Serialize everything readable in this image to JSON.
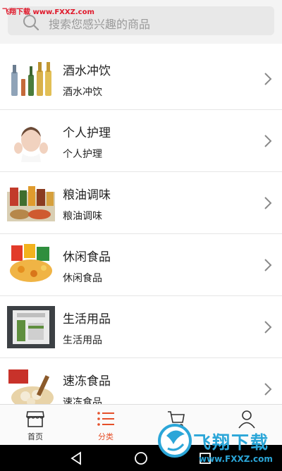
{
  "watermark_top": "飞翔下载 www.FXXZ.com",
  "search": {
    "placeholder": "搜索您感兴趣的商品",
    "icon": "search-icon"
  },
  "categories": [
    {
      "title": "酒水冲饮",
      "subtitle": "酒水冲饮"
    },
    {
      "title": "个人护理",
      "subtitle": "个人护理"
    },
    {
      "title": "粮油调味",
      "subtitle": "粮油调味"
    },
    {
      "title": "休闲食品",
      "subtitle": "休闲食品"
    },
    {
      "title": "生活用品",
      "subtitle": "生活用品"
    },
    {
      "title": "速冻食品",
      "subtitle": "速冻食品"
    }
  ],
  "tabbar": {
    "tabs": [
      {
        "label": "首页",
        "icon": "store-icon"
      },
      {
        "label": "分类",
        "icon": "list-icon"
      },
      {
        "label": "",
        "icon": "cart-icon"
      },
      {
        "label": "",
        "icon": "user-icon"
      }
    ],
    "active_color": "#e5502a"
  },
  "logo_watermark": {
    "text": "飞翔下载",
    "url": "www.FXXZ.com"
  }
}
